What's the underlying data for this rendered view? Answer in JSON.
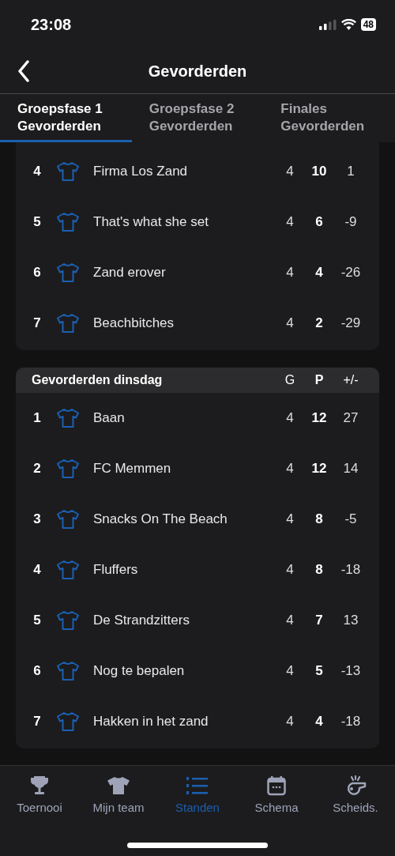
{
  "status_bar": {
    "time": "23:08",
    "battery": "48"
  },
  "nav": {
    "title": "Gevorderden"
  },
  "tabs": [
    {
      "line1": "Groepsfase 1",
      "line2": "Gevorderden",
      "selected": true
    },
    {
      "line1": "Groepsfase 2",
      "line2": "Gevorderden",
      "selected": false
    },
    {
      "line1": "Finales",
      "line2": "Gevorderden",
      "selected": false
    }
  ],
  "sections": [
    {
      "rows": [
        {
          "rank": "4",
          "team": "Firma Los Zand",
          "g": "4",
          "p": "10",
          "diff": "1"
        },
        {
          "rank": "5",
          "team": "That's what she set",
          "g": "4",
          "p": "6",
          "diff": "-9"
        },
        {
          "rank": "6",
          "team": "Zand erover",
          "g": "4",
          "p": "4",
          "diff": "-26"
        },
        {
          "rank": "7",
          "team": "Beachbitches",
          "g": "4",
          "p": "2",
          "diff": "-29"
        }
      ]
    },
    {
      "title": "Gevorderden dinsdag",
      "columns": [
        "G",
        "P",
        "+/-"
      ],
      "rows": [
        {
          "rank": "1",
          "team": "Baan",
          "g": "4",
          "p": "12",
          "diff": "27"
        },
        {
          "rank": "2",
          "team": "FC Memmen",
          "g": "4",
          "p": "12",
          "diff": "14"
        },
        {
          "rank": "3",
          "team": "Snacks On The Beach",
          "g": "4",
          "p": "8",
          "diff": "-5"
        },
        {
          "rank": "4",
          "team": "Fluffers",
          "g": "4",
          "p": "8",
          "diff": "-18"
        },
        {
          "rank": "5",
          "team": "De Strandzitters",
          "g": "4",
          "p": "7",
          "diff": "13"
        },
        {
          "rank": "6",
          "team": "Nog te bepalen",
          "g": "4",
          "p": "5",
          "diff": "-13"
        },
        {
          "rank": "7",
          "team": "Hakken in het zand",
          "g": "4",
          "p": "4",
          "diff": "-18"
        }
      ]
    }
  ],
  "tab_bar": [
    {
      "kind": "trophy",
      "label": "Toernooi",
      "selected": false
    },
    {
      "kind": "shirt",
      "label": "Mijn team",
      "selected": false
    },
    {
      "kind": "list",
      "label": "Standen",
      "selected": true
    },
    {
      "kind": "calendar",
      "label": "Schema",
      "selected": false
    },
    {
      "kind": "whistle",
      "label": "Scheids.",
      "selected": false
    }
  ]
}
